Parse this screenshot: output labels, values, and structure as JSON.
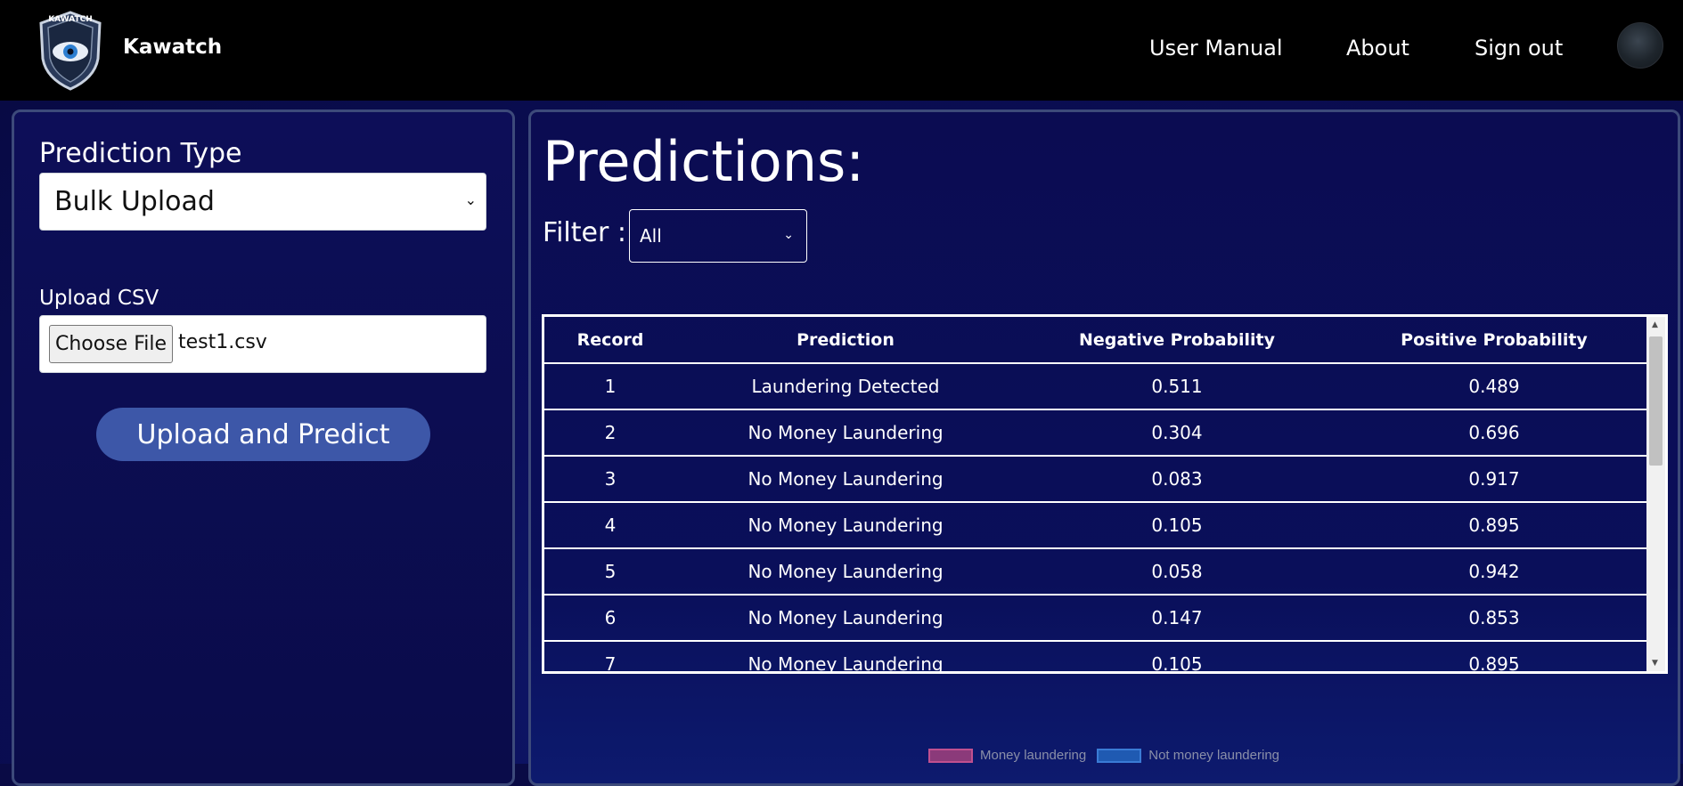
{
  "header": {
    "brand": "Kawatch",
    "logo_text": "KAWATCH",
    "nav": {
      "user_manual": "User Manual",
      "about": "About",
      "sign_out": "Sign out"
    }
  },
  "left_panel": {
    "prediction_type_label": "Prediction Type",
    "prediction_type_value": "Bulk Upload",
    "upload_label": "Upload CSV",
    "choose_file_label": "Choose File",
    "file_name": "test1.csv",
    "upload_button": "Upload and Predict"
  },
  "right_panel": {
    "title": "Predictions:",
    "filter_label": "Filter :",
    "filter_value": "All",
    "table": {
      "headers": [
        "Record",
        "Prediction",
        "Negative Probability",
        "Positive Probability"
      ],
      "rows": [
        [
          "1",
          "Laundering Detected",
          "0.511",
          "0.489"
        ],
        [
          "2",
          "No Money Laundering",
          "0.304",
          "0.696"
        ],
        [
          "3",
          "No Money Laundering",
          "0.083",
          "0.917"
        ],
        [
          "4",
          "No Money Laundering",
          "0.105",
          "0.895"
        ],
        [
          "5",
          "No Money Laundering",
          "0.058",
          "0.942"
        ],
        [
          "6",
          "No Money Laundering",
          "0.147",
          "0.853"
        ],
        [
          "7",
          "No Money Laundering",
          "0.105",
          "0.895"
        ]
      ]
    },
    "legend": {
      "money_laundering": "Money laundering",
      "not_money_laundering": "Not money laundering"
    }
  }
}
